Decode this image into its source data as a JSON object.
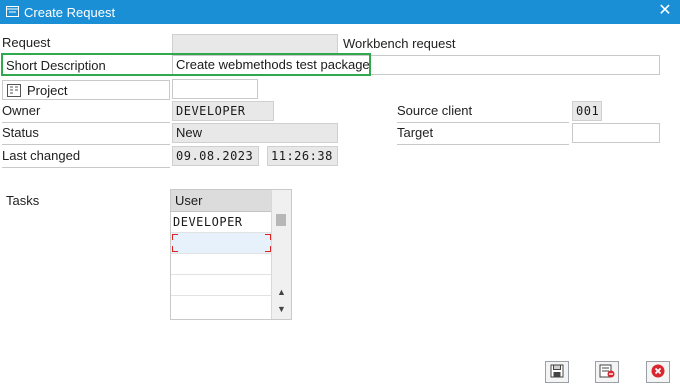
{
  "window": {
    "title": "Create Request"
  },
  "form": {
    "request_label": "Request",
    "request_value": "",
    "request_type": "Workbench request",
    "short_desc_label": "Short Description",
    "short_desc_value": "Create webmethods test package",
    "project_label": "Project",
    "project_value": "",
    "owner_label": "Owner",
    "owner_value": "DEVELOPER",
    "source_client_label": "Source client",
    "source_client_value": "001",
    "status_label": "Status",
    "status_value": "New",
    "target_label": "Target",
    "target_value": "",
    "last_changed_label": "Last changed",
    "last_changed_date": "09.08.2023",
    "last_changed_time": "11:26:38"
  },
  "tasks": {
    "label": "Tasks",
    "column_header": "User",
    "rows": [
      "DEVELOPER",
      "",
      "",
      "",
      ""
    ]
  },
  "icons": {
    "title": "window-icon",
    "close": "close-icon",
    "project": "project-icon",
    "save": "save-icon",
    "delete": "delete-icon",
    "cancel": "cancel-icon"
  },
  "colors": {
    "titlebar": "#1a8fd6",
    "highlight": "#2fa84f",
    "cancel": "#d9262e"
  }
}
